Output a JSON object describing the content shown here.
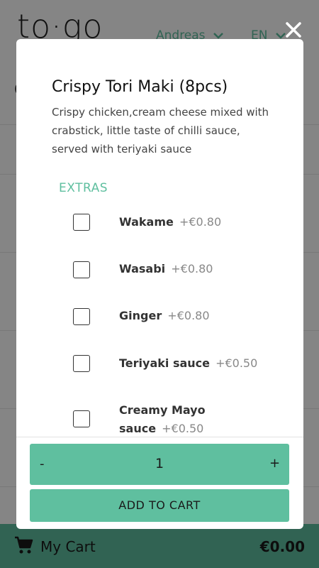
{
  "header": {
    "logo": "to·go",
    "user_name": "Andreas",
    "language": "EN"
  },
  "background": {
    "partial_text": "C"
  },
  "cart": {
    "label": "My Cart",
    "total": "€0.00"
  },
  "modal": {
    "title": "Crispy Tori Maki (8pcs)",
    "description": "Crispy chicken,cream cheese mixed with crabstick, little taste of chilli sauce, served with teriyaki sauce",
    "extras_heading": "EXTRAS",
    "extras": [
      {
        "name": "Wakame",
        "price": "+€0.80",
        "checked": false
      },
      {
        "name": "Wasabi",
        "price": "+€0.80",
        "checked": false
      },
      {
        "name": "Ginger",
        "price": "+€0.80",
        "checked": false
      },
      {
        "name": "Teriyaki sauce",
        "price": "+€0.50",
        "checked": false
      },
      {
        "name": "Creamy Mayo sauce",
        "price": "+€0.50",
        "checked": false
      }
    ],
    "quantity": {
      "minus_label": "-",
      "value": "1",
      "plus_label": "+"
    },
    "add_to_cart_label": "ADD TO CART"
  },
  "colors": {
    "accent": "#5fbf9f",
    "overlay": "rgba(0,0,0,0.48)"
  },
  "icons": {
    "close": "close-icon",
    "cart": "cart-icon",
    "chevron": "chevron-down-icon"
  }
}
